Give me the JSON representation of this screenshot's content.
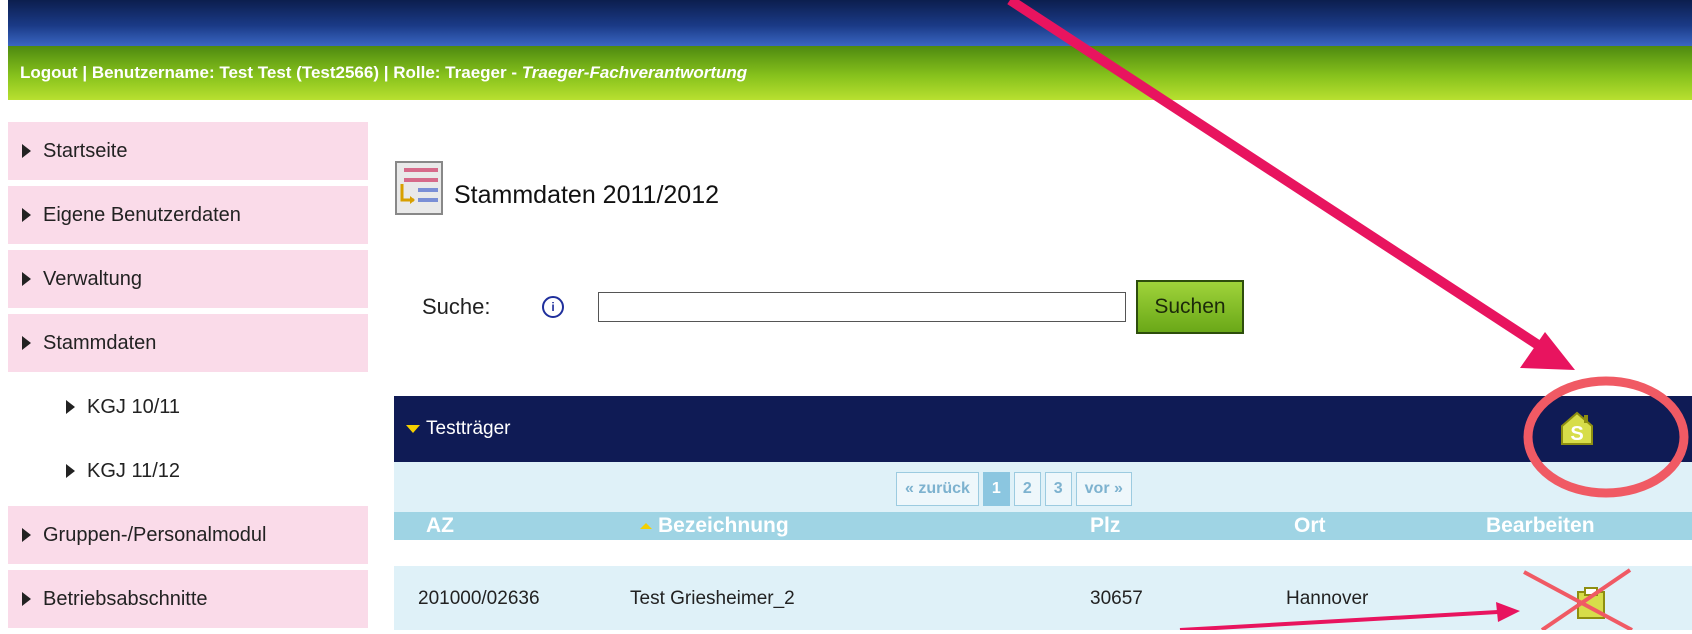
{
  "header": {
    "logout": "Logout",
    "username_label": "Benutzername: Test Test (Test2566)",
    "role_label": "Rolle: Traeger",
    "role_value": "Traeger-Fachverantwortung"
  },
  "sidebar": {
    "items": [
      {
        "label": "Startseite"
      },
      {
        "label": "Eigene Benutzerdaten"
      },
      {
        "label": "Verwaltung"
      },
      {
        "label": "Stammdaten"
      },
      {
        "label": "KGJ 10/11"
      },
      {
        "label": "KGJ 11/12"
      },
      {
        "label": "Gruppen-/Personalmodul"
      },
      {
        "label": "Betriebsabschnitte"
      }
    ]
  },
  "main": {
    "title": "Stammdaten 2011/2012",
    "search_label": "Suche:",
    "search_value": "",
    "search_button": "Suchen",
    "panel_title": "Testträger"
  },
  "pager": {
    "prev": "« zurück",
    "pages": [
      "1",
      "2",
      "3"
    ],
    "next": "vor »",
    "current": "1"
  },
  "table": {
    "headers": [
      "AZ",
      "Bezeichnung",
      "Plz",
      "Ort",
      "Bearbeiten"
    ],
    "rows": [
      {
        "az": "201000/02636",
        "bezeichnung": "Test Griesheimer_2",
        "plz": "30657",
        "ort": "Hannover"
      }
    ]
  },
  "colors": {
    "accent_green": "#87c21c",
    "nav_pink": "#fadbe9",
    "panel_navy": "#0f1b55",
    "annotation": "#e8145f"
  }
}
